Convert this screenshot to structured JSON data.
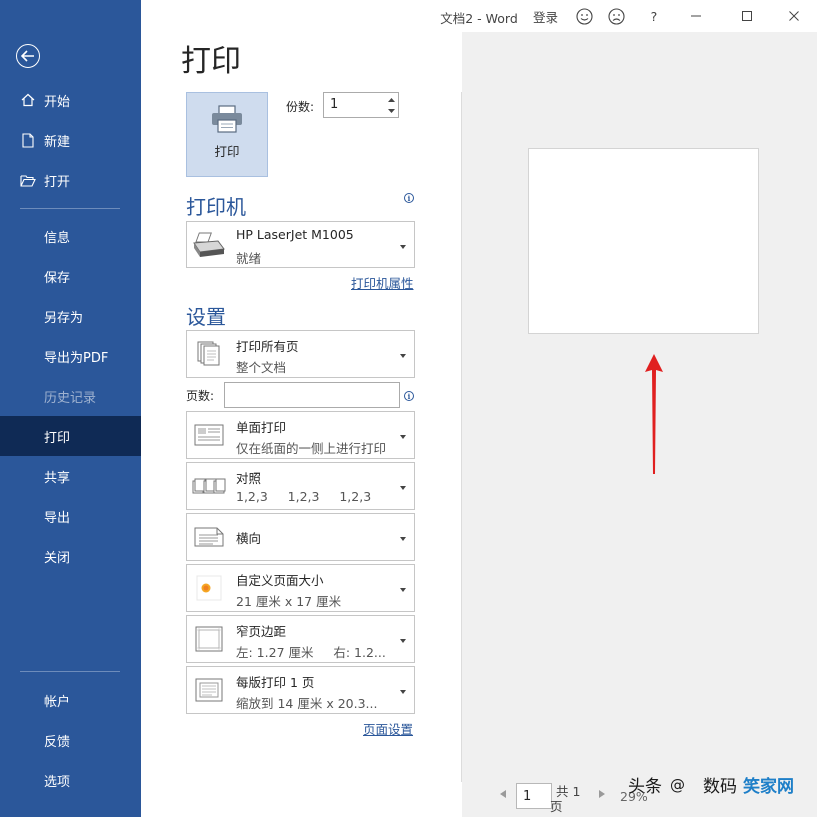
{
  "window": {
    "title": "文档2  -  Word",
    "login": "登录",
    "help": "?"
  },
  "sidebar": {
    "back_icon": "back-arrow-icon",
    "top_items": [
      {
        "label": "开始",
        "icon": "home-icon"
      },
      {
        "label": "新建",
        "icon": "new-document-icon"
      },
      {
        "label": "打开",
        "icon": "open-folder-icon"
      }
    ],
    "mid_items": [
      "信息",
      "保存",
      "另存为",
      "导出为PDF",
      "历史记录",
      "打印",
      "共享",
      "导出",
      "关闭"
    ],
    "bottom_items": [
      "帐户",
      "反馈",
      "选项"
    ],
    "active": "打印",
    "disabled": "历史记录"
  },
  "print": {
    "heading": "打印",
    "print_button": "打印",
    "copies_label": "份数:",
    "copies_value": "1"
  },
  "printer": {
    "section": "打印机",
    "name": "HP LaserJet M1005",
    "status": "就绪",
    "properties_link": "打印机属性"
  },
  "settings": {
    "section": "设置",
    "pages_label": "页数:",
    "pages_value": "",
    "items": [
      {
        "l1": "打印所有页",
        "l2": "整个文档",
        "icon": "pages-stack-icon"
      },
      {
        "l1": "单面打印",
        "l2": "仅在纸面的一侧上进行打印",
        "icon": "one-sided-icon"
      },
      {
        "l1": "对照",
        "l2": "1,2,3     1,2,3     1,2,3",
        "icon": "collated-icon"
      },
      {
        "l1": "横向",
        "l2": "",
        "icon": "landscape-icon"
      },
      {
        "l1": "自定义页面大小",
        "l2": "21 厘米 x 17 厘米",
        "icon": "paper-size-icon"
      },
      {
        "l1": "窄页边距",
        "l2": "左: 1.27 厘米     右: 1.2...",
        "icon": "margins-icon"
      },
      {
        "l1": "每版打印 1 页",
        "l2": "缩放到 14 厘米 x 20.3...",
        "icon": "pages-per-sheet-icon"
      }
    ],
    "page_setup_link": "页面设置"
  },
  "preview": {
    "page_value": "1",
    "total_label": "共 1",
    "total_unit": "页",
    "zoom": "29%"
  },
  "watermark": {
    "text1": "头条",
    "text2": "@",
    "text3": "数码",
    "text4": "笑家网"
  },
  "colors": {
    "sidebar": "#2b579a",
    "sidebar_active": "#0f2a55",
    "accent": "#2b579a",
    "arrow": "#e02020"
  }
}
